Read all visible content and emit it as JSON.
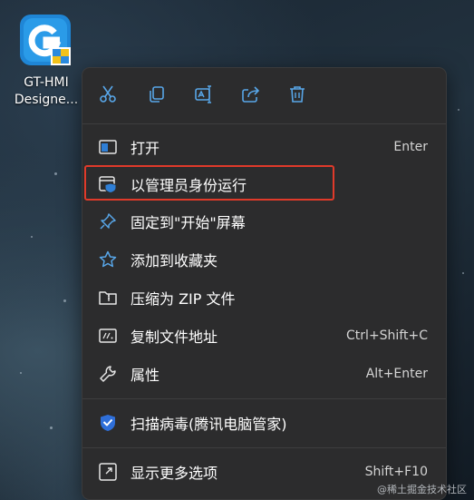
{
  "desktop": {
    "icon_label": "GT-HMI\nDesigne..."
  },
  "toolbar": {
    "cut": "cut-icon",
    "copy": "copy-icon",
    "rename": "rename-icon",
    "share": "share-icon",
    "delete": "delete-icon"
  },
  "menu": {
    "items": [
      {
        "label": "打开",
        "shortcut": "Enter",
        "icon": "open-window-icon"
      },
      {
        "label": "以管理员身份运行",
        "shortcut": "",
        "icon": "shield-admin-icon"
      },
      {
        "label": "固定到\"开始\"屏幕",
        "shortcut": "",
        "icon": "pin-icon"
      },
      {
        "label": "添加到收藏夹",
        "shortcut": "",
        "icon": "star-icon"
      },
      {
        "label": "压缩为 ZIP 文件",
        "shortcut": "",
        "icon": "zip-folder-icon"
      },
      {
        "label": "复制文件地址",
        "shortcut": "Ctrl+Shift+C",
        "icon": "copy-path-icon"
      },
      {
        "label": "属性",
        "shortcut": "Alt+Enter",
        "icon": "wrench-icon"
      },
      {
        "label": "扫描病毒(腾讯电脑管家)",
        "shortcut": "",
        "icon": "tencent-shield-icon"
      },
      {
        "label": "显示更多选项",
        "shortcut": "Shift+F10",
        "icon": "more-options-icon"
      }
    ]
  },
  "colors": {
    "menu_bg": "#2c2c2d",
    "accent_icon": "#58a6e8",
    "highlight_border": "#e03a2a"
  },
  "watermark": "@稀土掘金技术社区"
}
